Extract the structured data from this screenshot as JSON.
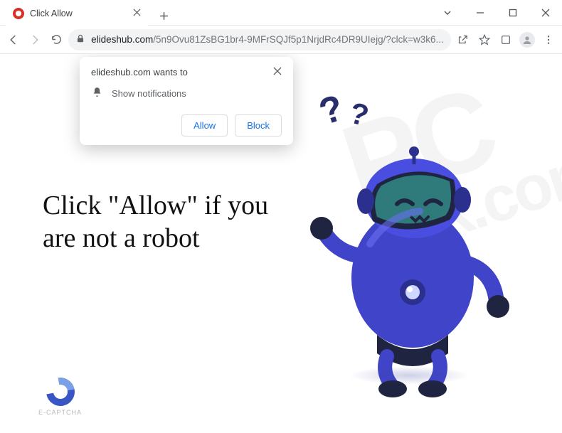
{
  "window": {
    "tab_title": "Click Allow"
  },
  "address_bar": {
    "domain": "elideshub.com",
    "path": "/5n9Ovu81ZsBG1br4-9MFrSQJf5p1NrjdRc4DR9UIejg/?clck=w3k6..."
  },
  "permission_prompt": {
    "origin_text": "elideshub.com wants to",
    "capability": "Show notifications",
    "allow_label": "Allow",
    "block_label": "Block"
  },
  "page": {
    "headline": "Click \"Allow\" if you are not a robot",
    "captcha_label": "E-CAPTCHA",
    "question_mark": "?"
  },
  "watermark": {
    "line1": "PC",
    "line2": "risk.com"
  }
}
